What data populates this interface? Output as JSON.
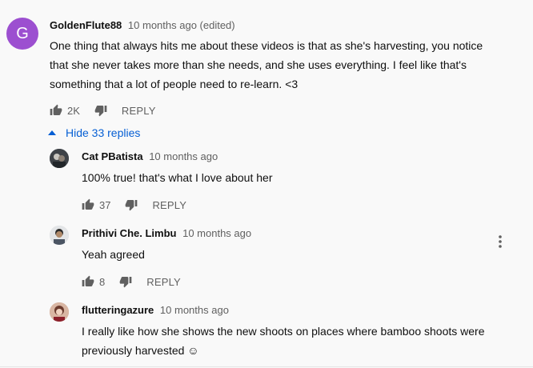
{
  "main_comment": {
    "avatar_letter": "G",
    "author": "GoldenFlute88",
    "time": "10 months ago (edited)",
    "text_lines": [
      "One thing that always hits me about these videos is that as she's harvesting, you notice",
      "that she never takes more than she needs, and she uses everything.  I feel like that's",
      "something that a lot of people need to re-learn. <3"
    ],
    "likes": "2K",
    "reply_label": "REPLY"
  },
  "replies_toggle": {
    "label": "Hide 33 replies",
    "color": "#065fd4"
  },
  "replies": [
    {
      "author": "Cat PBatista",
      "time": "10 months ago",
      "text_lines": [
        "100% true! that's what I love about her"
      ],
      "likes": "37",
      "reply_label": "REPLY"
    },
    {
      "author": "Prithivi Che. Limbu",
      "time": "10 months ago",
      "text_lines": [
        "Yeah agreed"
      ],
      "likes": "8",
      "reply_label": "REPLY"
    },
    {
      "author": "flutteringazure",
      "time": "10 months ago",
      "text_lines": [
        "I really like how she shows the new shoots on places where bamboo shoots were",
        "previously harvested ☺"
      ]
    }
  ],
  "icons": {
    "like": "thumbs-up-icon",
    "dislike": "thumbs-down-icon",
    "toggle": "caret-up-icon",
    "menu": "more-vertical-icon"
  },
  "colors": {
    "avatar_g": "#9c4fd0",
    "text": "#0f0f0f",
    "meta": "#606060",
    "background": "#f9f9f9"
  }
}
